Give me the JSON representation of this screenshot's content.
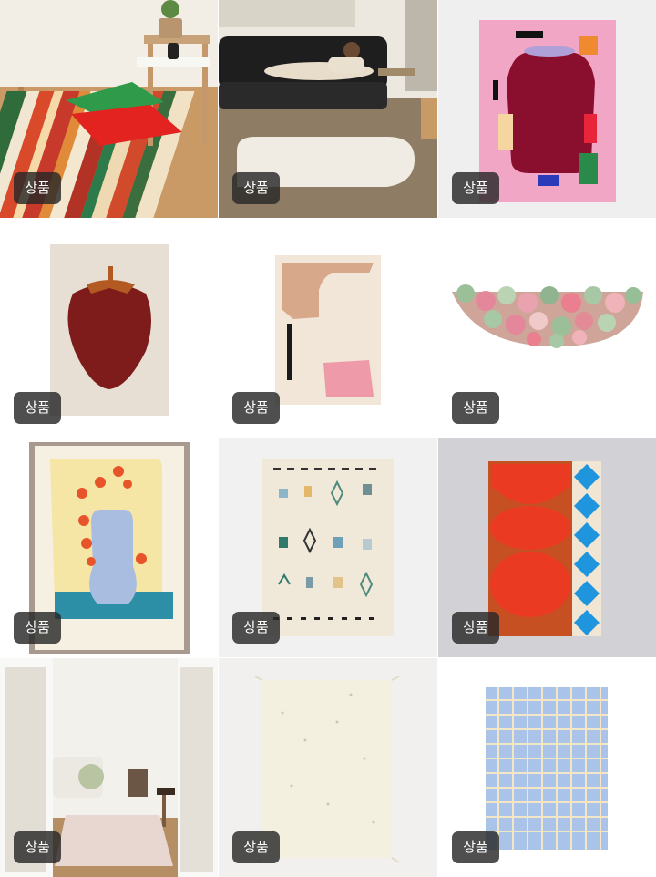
{
  "grid": {
    "items": [
      {
        "badge": "상품",
        "subject": "striped-runner-rug-with-floor-cushions"
      },
      {
        "badge": "상품",
        "subject": "rounded-cream-rug-living-room"
      },
      {
        "badge": "상품",
        "subject": "pink-vase-art-rug"
      },
      {
        "badge": "상품",
        "subject": "strawberry-tufted-rug"
      },
      {
        "badge": "상품",
        "subject": "abstract-shapes-cream-rug"
      },
      {
        "badge": "상품",
        "subject": "half-moon-pom-pom-rug"
      },
      {
        "badge": "상품",
        "subject": "vase-flowers-woven-throw"
      },
      {
        "badge": "상품",
        "subject": "berber-symbols-rug"
      },
      {
        "badge": "상품",
        "subject": "red-circles-blue-diamond-rug"
      },
      {
        "badge": "상품",
        "subject": "bedroom-doorway-check-rug"
      },
      {
        "badge": "상품",
        "subject": "ivory-fringed-rug"
      },
      {
        "badge": "상품",
        "subject": "blue-grid-check-rug"
      }
    ]
  }
}
